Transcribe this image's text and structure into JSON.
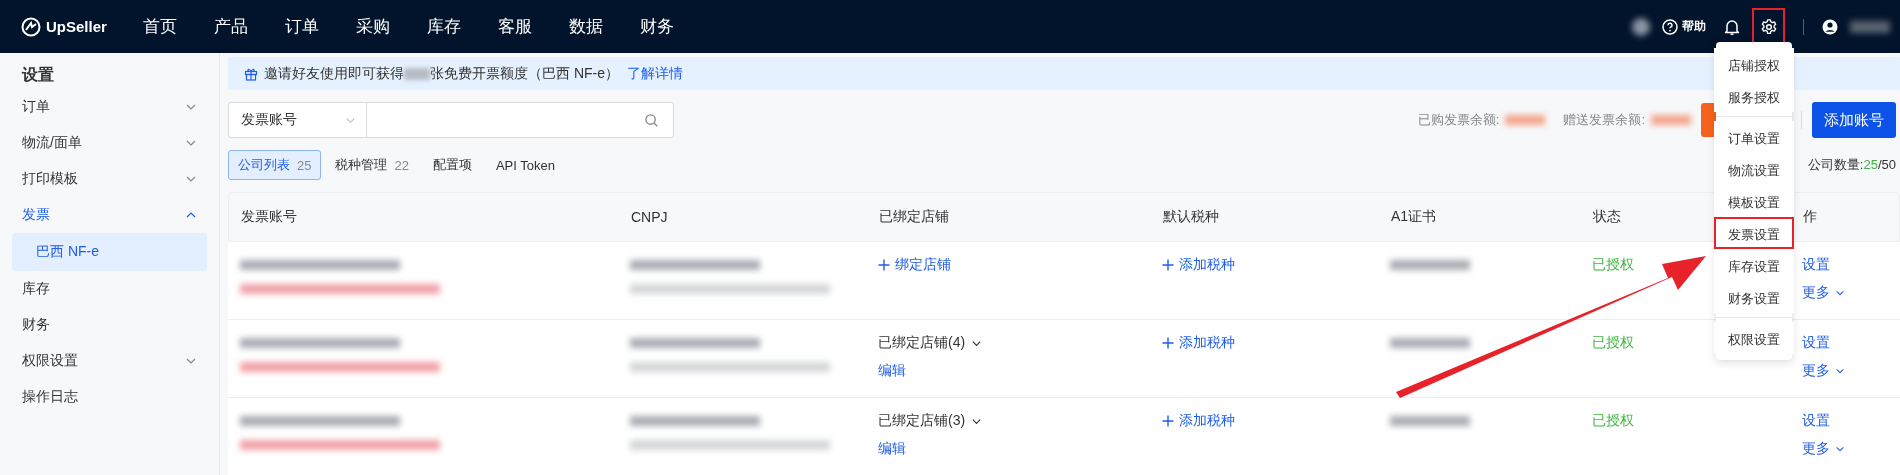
{
  "nav": {
    "logo": "UpSeller",
    "items": [
      {
        "label": "首页"
      },
      {
        "label": "产品"
      },
      {
        "label": "订单"
      },
      {
        "label": "采购"
      },
      {
        "label": "库存"
      },
      {
        "label": "客服"
      },
      {
        "label": "数据"
      },
      {
        "label": "财务"
      }
    ],
    "help": "帮助",
    "settings_highlighted": true
  },
  "settings_menu": {
    "groups": [
      [
        {
          "label": "店铺授权",
          "selected": false
        },
        {
          "label": "服务授权",
          "selected": false
        }
      ],
      [
        {
          "label": "订单设置",
          "selected": false
        },
        {
          "label": "物流设置",
          "selected": false
        },
        {
          "label": "模板设置",
          "selected": false
        },
        {
          "label": "发票设置",
          "selected": true
        },
        {
          "label": "库存设置",
          "selected": false
        },
        {
          "label": "财务设置",
          "selected": false
        }
      ],
      [
        {
          "label": "权限设置",
          "selected": false
        }
      ]
    ]
  },
  "sidebar": {
    "title": "设置",
    "items": [
      {
        "kind": "group",
        "label": "订单",
        "expanded": false
      },
      {
        "kind": "group",
        "label": "物流/面单",
        "expanded": false
      },
      {
        "kind": "group",
        "label": "打印模板",
        "expanded": false
      },
      {
        "kind": "group",
        "label": "发票",
        "expanded": true,
        "children": [
          {
            "label": "巴西 NF-e",
            "selected": true
          }
        ]
      },
      {
        "kind": "link",
        "label": "库存",
        "selected": false
      },
      {
        "kind": "link",
        "label": "财务",
        "selected": false
      },
      {
        "kind": "group",
        "label": "权限设置",
        "expanded": false
      },
      {
        "kind": "link",
        "label": "操作日志",
        "selected": false
      }
    ]
  },
  "banner": {
    "text_before": "邀请好友使用即可获得",
    "text_after": "张免费开票额度（巴西 NF-e）",
    "link": "了解详情"
  },
  "filter": {
    "select": "发票账号"
  },
  "balances": [
    {
      "label": "已购发票余额:"
    },
    {
      "label": "赠送发票余额:"
    }
  ],
  "add_button": "添加账号",
  "tabs": [
    {
      "label": "公司列表",
      "count": "25",
      "selected": true
    },
    {
      "label": "税种管理",
      "count": "22",
      "selected": false
    },
    {
      "label": "配置项",
      "selected": false
    },
    {
      "label": "API Token",
      "selected": false
    }
  ],
  "company_count": {
    "label": "公司数量:",
    "used": "25",
    "total": "/50"
  },
  "table": {
    "columns": [
      "发票账号",
      "CNPJ",
      "已绑定店铺",
      "默认税种",
      "A1证书",
      "状态",
      "作"
    ],
    "rows": [
      {
        "shops": {
          "kind": "bind",
          "label": "绑定店铺"
        },
        "tax": "添加税种",
        "status": "已授权",
        "actions": [
          "设置",
          "更多"
        ]
      },
      {
        "shops": {
          "kind": "bound",
          "label": "已绑定店铺(4)",
          "edit": "编辑"
        },
        "tax": "添加税种",
        "status": "已授权",
        "actions": [
          "设置",
          "更多"
        ]
      },
      {
        "shops": {
          "kind": "bound",
          "label": "已绑定店铺(3)",
          "edit": "编辑"
        },
        "tax": "添加税种",
        "status": "已授权",
        "actions": [
          "设置",
          "更多"
        ]
      }
    ]
  }
}
